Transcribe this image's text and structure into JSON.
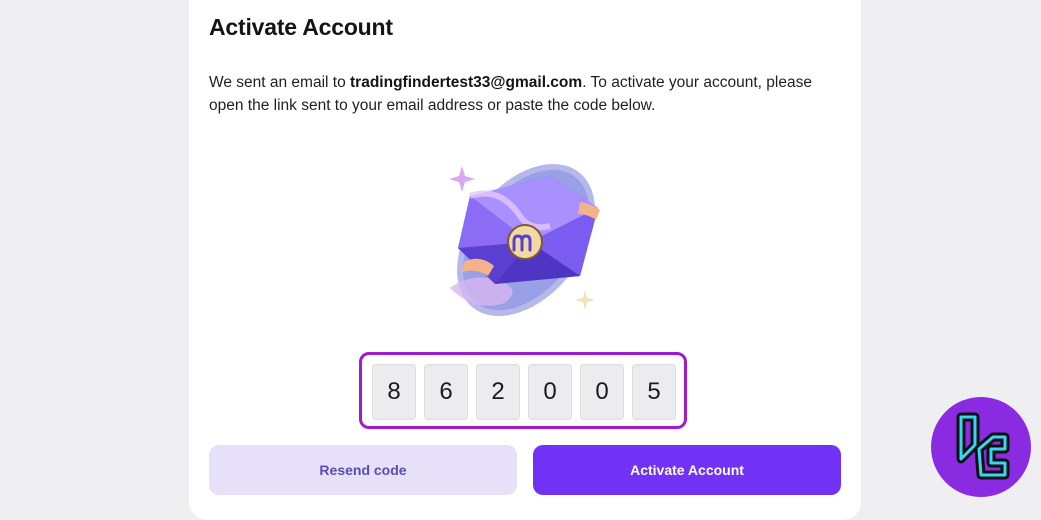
{
  "header": {
    "title": "Activate Account"
  },
  "message": {
    "prefix": "We sent an email to ",
    "email": "tradingfindertest33@gmail.com",
    "suffix": ". To activate your account, please open the link sent to your email address or paste the code below."
  },
  "code": {
    "digits": [
      "8",
      "6",
      "2",
      "0",
      "0",
      "5"
    ]
  },
  "buttons": {
    "resend_label": "Resend code",
    "activate_label": "Activate Account"
  },
  "colors": {
    "accent": "#7132f5",
    "highlight_border": "#a21ad0",
    "resend_bg": "#e6e1f9",
    "logo_bg": "#8a2be2",
    "logo_line": "#34d8f2"
  },
  "icons": {
    "illustration": "envelope-illustration",
    "watermark": "tradingfinder-logo"
  }
}
